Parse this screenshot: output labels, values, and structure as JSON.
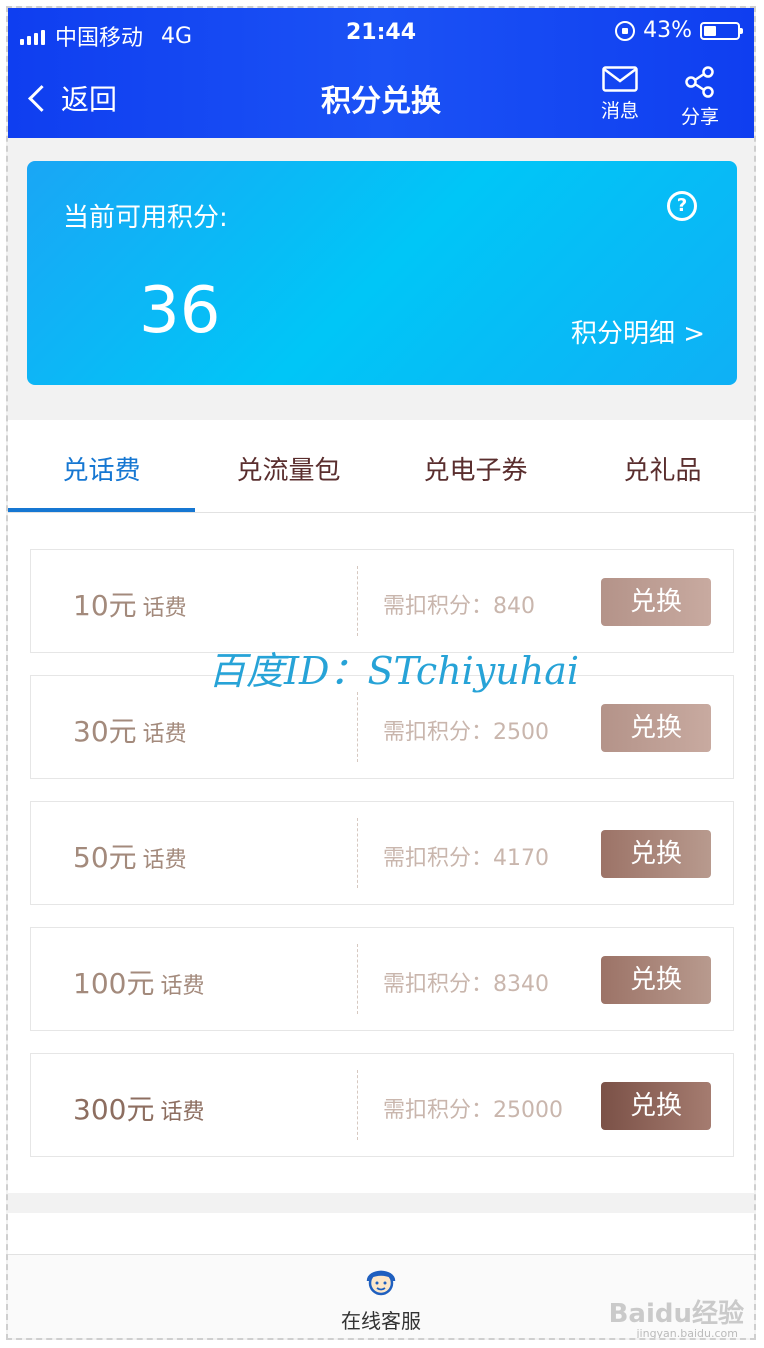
{
  "status_bar": {
    "carrier": "中国移动",
    "network": "4G",
    "time": "21:44",
    "battery": "43%"
  },
  "nav": {
    "back_label": "返回",
    "title": "积分兑换",
    "message_label": "消息",
    "share_label": "分享"
  },
  "points": {
    "label": "当前可用积分:",
    "value": "36",
    "detail_link": "积分明细 >",
    "help_glyph": "?"
  },
  "tabs": [
    {
      "label": "兑话费",
      "active": true
    },
    {
      "label": "兑流量包",
      "active": false
    },
    {
      "label": "兑电子券",
      "active": false
    },
    {
      "label": "兑礼品",
      "active": false
    }
  ],
  "items": [
    {
      "amount": "10元",
      "unit": "话费",
      "cost_label": "需扣积分：",
      "cost": "840",
      "button": "兑换"
    },
    {
      "amount": "30元",
      "unit": "话费",
      "cost_label": "需扣积分：",
      "cost": "2500",
      "button": "兑换"
    },
    {
      "amount": "50元",
      "unit": "话费",
      "cost_label": "需扣积分：",
      "cost": "4170",
      "button": "兑换"
    },
    {
      "amount": "100元",
      "unit": "话费",
      "cost_label": "需扣积分：",
      "cost": "8340",
      "button": "兑换"
    },
    {
      "amount": "300元",
      "unit": "话费",
      "cost_label": "需扣积分：",
      "cost": "25000",
      "button": "兑换"
    }
  ],
  "watermark": "百度ID：STchiyuhai",
  "bottom": {
    "service_label": "在线客服",
    "baidu_mark": "Baidu经验",
    "baidu_sub": "jingyan.baidu.com"
  },
  "colors": {
    "header": "#1b52f5",
    "points_card": "#00c6f7",
    "tab_active": "#1677d2",
    "button": "#b49389"
  }
}
